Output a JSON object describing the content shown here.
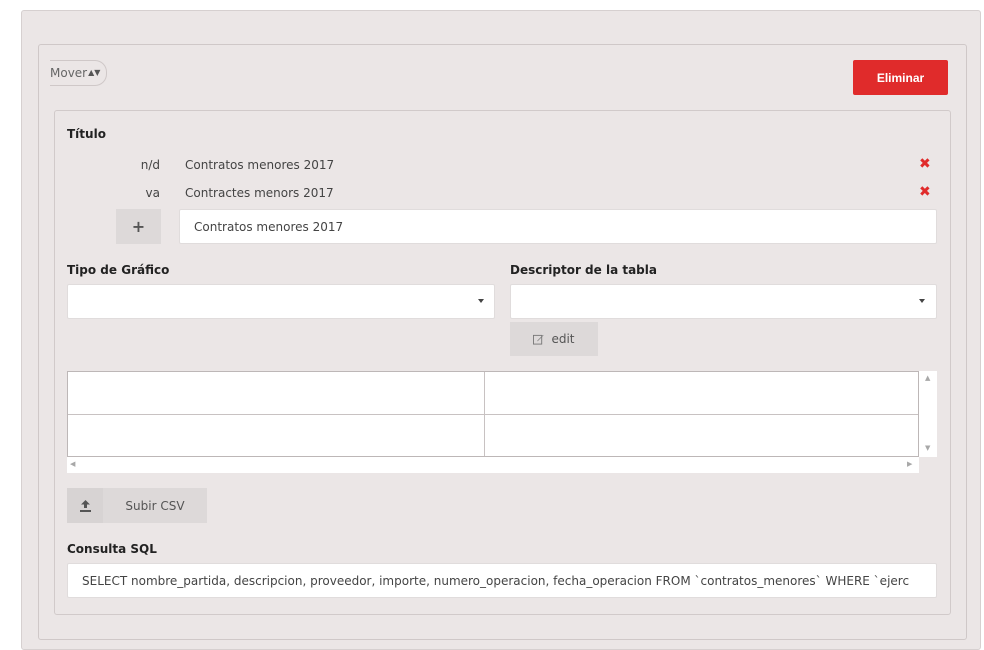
{
  "header": {
    "move_label": "Mover",
    "move_arrows": "▲▼",
    "delete_label": "Eliminar"
  },
  "title_section": {
    "label": "Título",
    "translations": [
      {
        "lang": "n/d",
        "text": "Contratos menores 2017"
      },
      {
        "lang": "va",
        "text": "Contractes menors 2017"
      }
    ],
    "add_symbol": "+",
    "input_value": "Contratos menores 2017"
  },
  "chart_type": {
    "label": "Tipo de Gráfico",
    "selected": ""
  },
  "table_descriptor": {
    "label": "Descriptor de la tabla",
    "selected": "",
    "edit_label": "edit"
  },
  "data_grid": {
    "rows": [
      [
        "",
        ""
      ],
      [
        "",
        ""
      ]
    ]
  },
  "upload": {
    "label": "Subir CSV"
  },
  "sql": {
    "label": "Consulta SQL",
    "value": "SELECT nombre_partida, descripcion, proveedor, importe, numero_operacion, fecha_operacion FROM `contratos_menores` WHERE `ejerc"
  },
  "colors": {
    "danger": "#e02b2b",
    "panel_bg": "#ebe6e6"
  },
  "icons": {
    "delete": "times-icon",
    "edit": "edit-icon",
    "upload": "upload-icon"
  }
}
